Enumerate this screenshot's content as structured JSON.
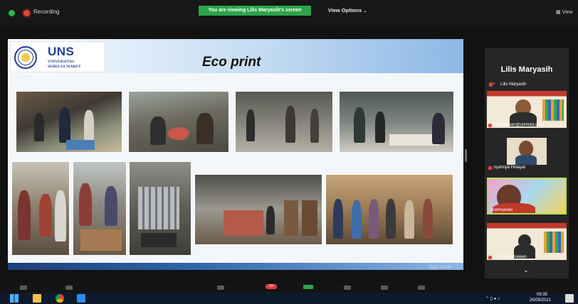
{
  "topbar": {
    "recording_label": "Recording",
    "viewing_banner": "You are viewing Lilis Maryasih's screen",
    "view_options_label": "View Options",
    "view_button_label": "View"
  },
  "slide": {
    "logo_text": "UNS",
    "logo_sub1": "UNIVERSITAS",
    "logo_sub2": "SEBELAS MARET",
    "title": "Eco print",
    "footer_watermark": "fppt.com"
  },
  "gallery": {
    "active_speaker_name": "Lilis Maryasih",
    "self_label": "Lilis Maryasih",
    "participants": [
      {
        "name": "arfaniahsan@unimed.ac.id"
      },
      {
        "name": "Syahrijal Hidayat"
      },
      {
        "name": "Rahmawati"
      },
      {
        "name": "Ferdi Anggriawan"
      }
    ]
  },
  "meeting_toolbar": {
    "chat_badge": "33"
  },
  "taskbar": {
    "time": "09.35",
    "date": "25/09/2021"
  },
  "colors": {
    "banner_green": "#2ca44a",
    "recording_red": "#e2453c",
    "speaking_border": "#b8e04a",
    "uns_blue": "#1e3e8c"
  }
}
